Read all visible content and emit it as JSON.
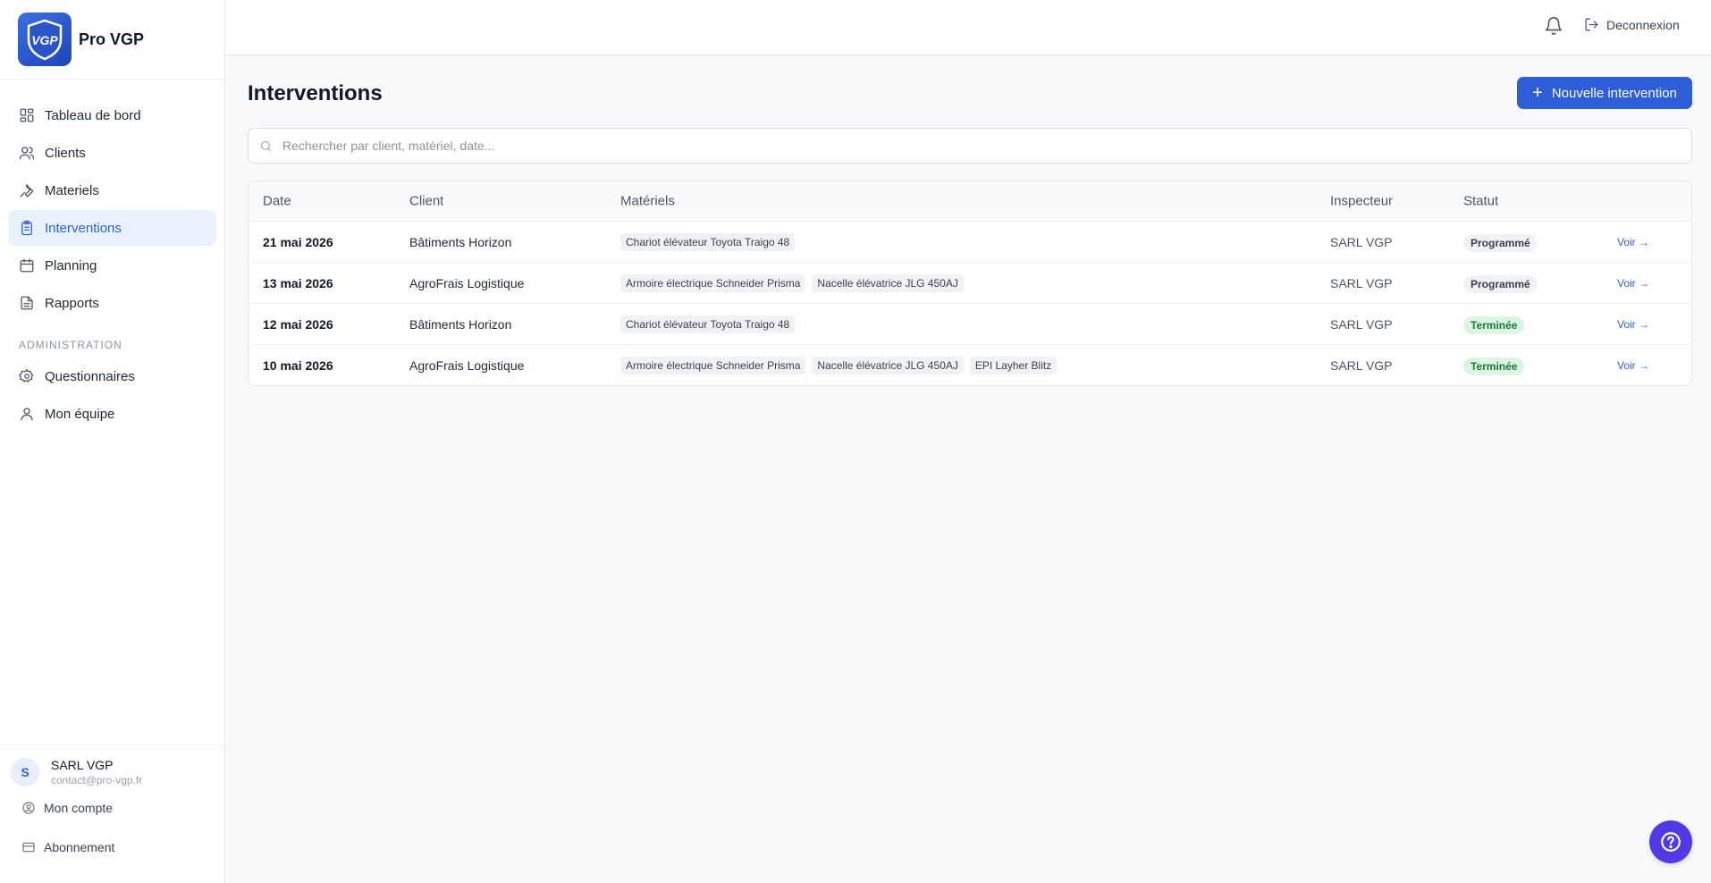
{
  "brand": {
    "name": "Pro VGP",
    "logo_text": "VGP"
  },
  "sidebar": {
    "items": [
      {
        "label": "Tableau de bord",
        "icon": "dashboard-icon"
      },
      {
        "label": "Clients",
        "icon": "users-icon"
      },
      {
        "label": "Materiels",
        "icon": "wrench-icon"
      },
      {
        "label": "Interventions",
        "icon": "clipboard-icon",
        "active": true
      },
      {
        "label": "Planning",
        "icon": "calendar-icon"
      },
      {
        "label": "Rapports",
        "icon": "file-icon"
      }
    ],
    "admin_section": "ADMINISTRATION",
    "admin_items": [
      {
        "label": "Questionnaires",
        "icon": "gear-icon"
      },
      {
        "label": "Mon équipe",
        "icon": "user-icon"
      }
    ],
    "user": {
      "initial": "S",
      "name": "SARL VGP",
      "email": "contact@pro-vgp.fr"
    },
    "footer_links": [
      {
        "label": "Mon compte",
        "icon": "account-icon"
      },
      {
        "label": "Abonnement",
        "icon": "credit-card-icon"
      }
    ]
  },
  "topbar": {
    "logout_label": "Deconnexion"
  },
  "main": {
    "title": "Interventions",
    "new_button_label": "Nouvelle intervention",
    "search_placeholder": "Rechercher par client, matériel, date...",
    "columns": [
      "Date",
      "Client",
      "Matériels",
      "Inspecteur",
      "Statut"
    ],
    "rows": [
      {
        "date": "21 mai 2026",
        "client": "Bâtiments Horizon",
        "materiels": [
          "Chariot élévateur Toyota Traigo 48"
        ],
        "inspecteur": "SARL VGP",
        "statut": "Programmé",
        "statut_type": "prog",
        "action": "Voir →"
      },
      {
        "date": "13 mai 2026",
        "client": "AgroFrais Logistique",
        "materiels": [
          "Armoire électrique Schneider Prisma",
          "Nacelle élévatrice JLG 450AJ"
        ],
        "inspecteur": "SARL VGP",
        "statut": "Programmé",
        "statut_type": "prog",
        "action": "Voir →"
      },
      {
        "date": "12 mai 2026",
        "client": "Bâtiments Horizon",
        "materiels": [
          "Chariot élévateur Toyota Traigo 48"
        ],
        "inspecteur": "SARL VGP",
        "statut": "Terminée",
        "statut_type": "done",
        "action": "Voir →"
      },
      {
        "date": "10 mai 2026",
        "client": "AgroFrais Logistique",
        "materiels": [
          "Armoire électrique Schneider Prisma",
          "Nacelle élévatrice JLG 450AJ",
          "EPI Layher Blitz"
        ],
        "inspecteur": "SARL VGP",
        "statut": "Terminée",
        "statut_type": "done",
        "action": "Voir →"
      }
    ]
  },
  "colors": {
    "accent": "#2f5fd8",
    "help": "#4f3ae6",
    "done_bg": "#dcf5e3",
    "done_text": "#1a7a3b"
  }
}
